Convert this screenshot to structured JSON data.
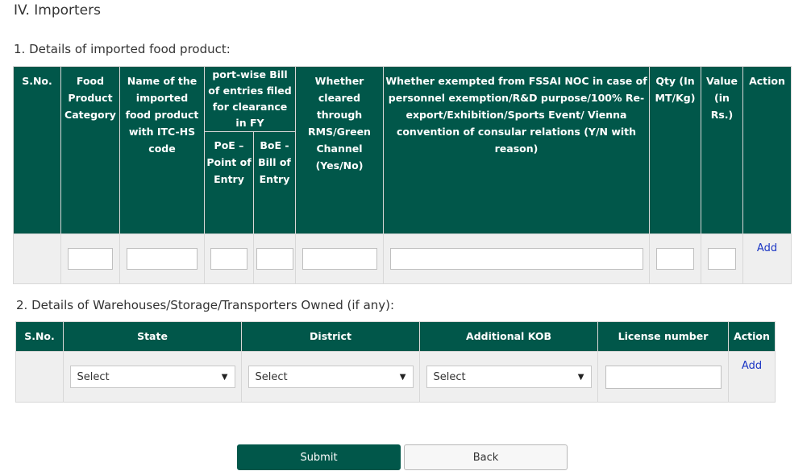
{
  "section": {
    "title": "IV. Importers"
  },
  "products": {
    "title": "1.  Details of imported food product:",
    "headers": {
      "sno": "S.No.",
      "category": "Food Product Category",
      "name": "Name of the imported food product with ITC-HS code",
      "port_group": "port-wise Bill of entries filed for clearance in FY",
      "poe": "PoE – Point of Entry",
      "boe": "BoE - Bill of Entry",
      "rms": "Whether cleared through RMS/Green Channel (Yes/No)",
      "exempted": "Whether exempted from FSSAI NOC in case of personnel exemption/R&D purpose/100% Re-export/Exhibition/Sports Event/ Vienna convention of consular relations (Y/N with reason)",
      "qty": "Qty (In MT/Kg)",
      "value": "Value (in Rs.)",
      "action": "Action"
    },
    "row": {
      "sno": "",
      "category": "",
      "name": "",
      "poe": "",
      "boe": "",
      "rms": "",
      "exempted": "",
      "qty": "",
      "value": "",
      "add_label": "Add"
    }
  },
  "warehouses": {
    "title": "2. Details of Warehouses/Storage/Transporters Owned (if any):",
    "headers": {
      "sno": "S.No.",
      "state": "State",
      "district": "District",
      "kob": "Additional KOB",
      "license": "License number",
      "action": "Action"
    },
    "row": {
      "sno": "",
      "state_selected": "Select",
      "district_selected": "Select",
      "kob_selected": "Select",
      "license": "",
      "add_label": "Add"
    }
  },
  "buttons": {
    "submit": "Submit",
    "back": "Back"
  },
  "colors": {
    "header_bg": "#01574a",
    "row_bg": "#efefef",
    "link": "#1a35c4"
  }
}
